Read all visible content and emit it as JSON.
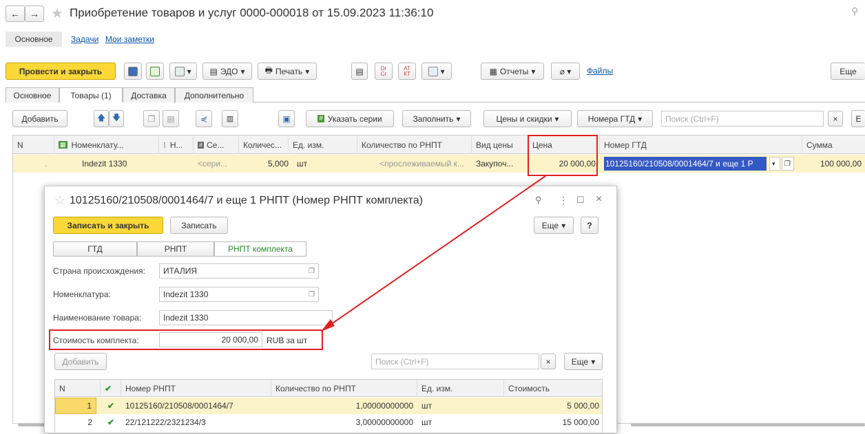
{
  "window": {
    "title": "Приобретение товаров и услуг 0000-000018 от 15.09.2023 11:36:10"
  },
  "nav_links": {
    "main": "Основное",
    "tasks": "Задачи",
    "notes": "Мои заметки"
  },
  "toolbar": {
    "post_close": "Провести и закрыть",
    "edo": "ЭДО",
    "print": "Печать",
    "dr": "Dr",
    "cr": "Cr",
    "at": "АТ",
    "kt": "КТ",
    "reports": "Отчеты",
    "files": "Файлы",
    "more": "Еще"
  },
  "tabs": [
    "Основное",
    "Товары (1)",
    "Доставка",
    "Дополнительно"
  ],
  "goods_toolbar": {
    "add": "Добавить",
    "series": "Указать серии",
    "fill": "Заполнить",
    "prices": "Цены и скидки",
    "gtd": "Номера ГТД",
    "search_placeholder": "Поиск (Ctrl+F)",
    "clear": "×",
    "more_cut": "Е"
  },
  "table": {
    "headers": [
      "N",
      "Номенклату...",
      "Н...",
      "Се...",
      "Количес...",
      "Ед. изм.",
      "Количество по РНПТ",
      "Вид цены",
      "Цена",
      "Номер ГТД",
      "Сумма"
    ],
    "row": {
      "n": ".",
      "nomenclature": "Indezit 1330",
      "series": "<сери...",
      "qty": "5,000",
      "unit": "шт",
      "rnpt_qty": "<прослеживаемый к...",
      "price_type": "Закупоч...",
      "price": "20 000,00",
      "gtd": "10125160/210508/0001464/7 и еще 1 Р",
      "sum": "100 000,00"
    }
  },
  "dialog": {
    "title": "10125160/210508/0001464/7 и еще 1 РНПТ (Номер РНПТ комплекта)",
    "save_close": "Записать и закрыть",
    "save": "Записать",
    "more": "Еще",
    "help": "?",
    "subtabs": [
      "ГТД",
      "РНПТ",
      "РНПТ комплекта"
    ],
    "country_label": "Страна происхождения:",
    "country_value": "ИТАЛИЯ",
    "nomen_label": "Номенклатура:",
    "nomen_value": "Indezit 1330",
    "name_label": "Наименование товара:",
    "name_value": "Indezit 1330",
    "cost_label": "Стоимость комплекта:",
    "cost_value": "20 000,00",
    "cost_unit": "RUB за шт",
    "add": "Добавить",
    "search_placeholder": "Поиск (Ctrl+F)",
    "clear": "×",
    "list_headers": [
      "N",
      "Номер РНПТ",
      "Количество по РНПТ",
      "Ед. изм.",
      "Стоимость"
    ],
    "rows": [
      {
        "n": "1",
        "number": "10125160/210508/0001464/7",
        "qty": "1,00000000000",
        "unit": "шт",
        "cost": "5 000,00"
      },
      {
        "n": "2",
        "number": "22/121222/2321234/3",
        "qty": "3,00000000000",
        "unit": "шт",
        "cost": "15 000,00"
      }
    ]
  },
  "colors": {
    "accent_yellow": "#fbd838",
    "highlight_red": "#e02020",
    "selection_row": "#fdf3c8",
    "link_blue": "#0b56a8"
  }
}
